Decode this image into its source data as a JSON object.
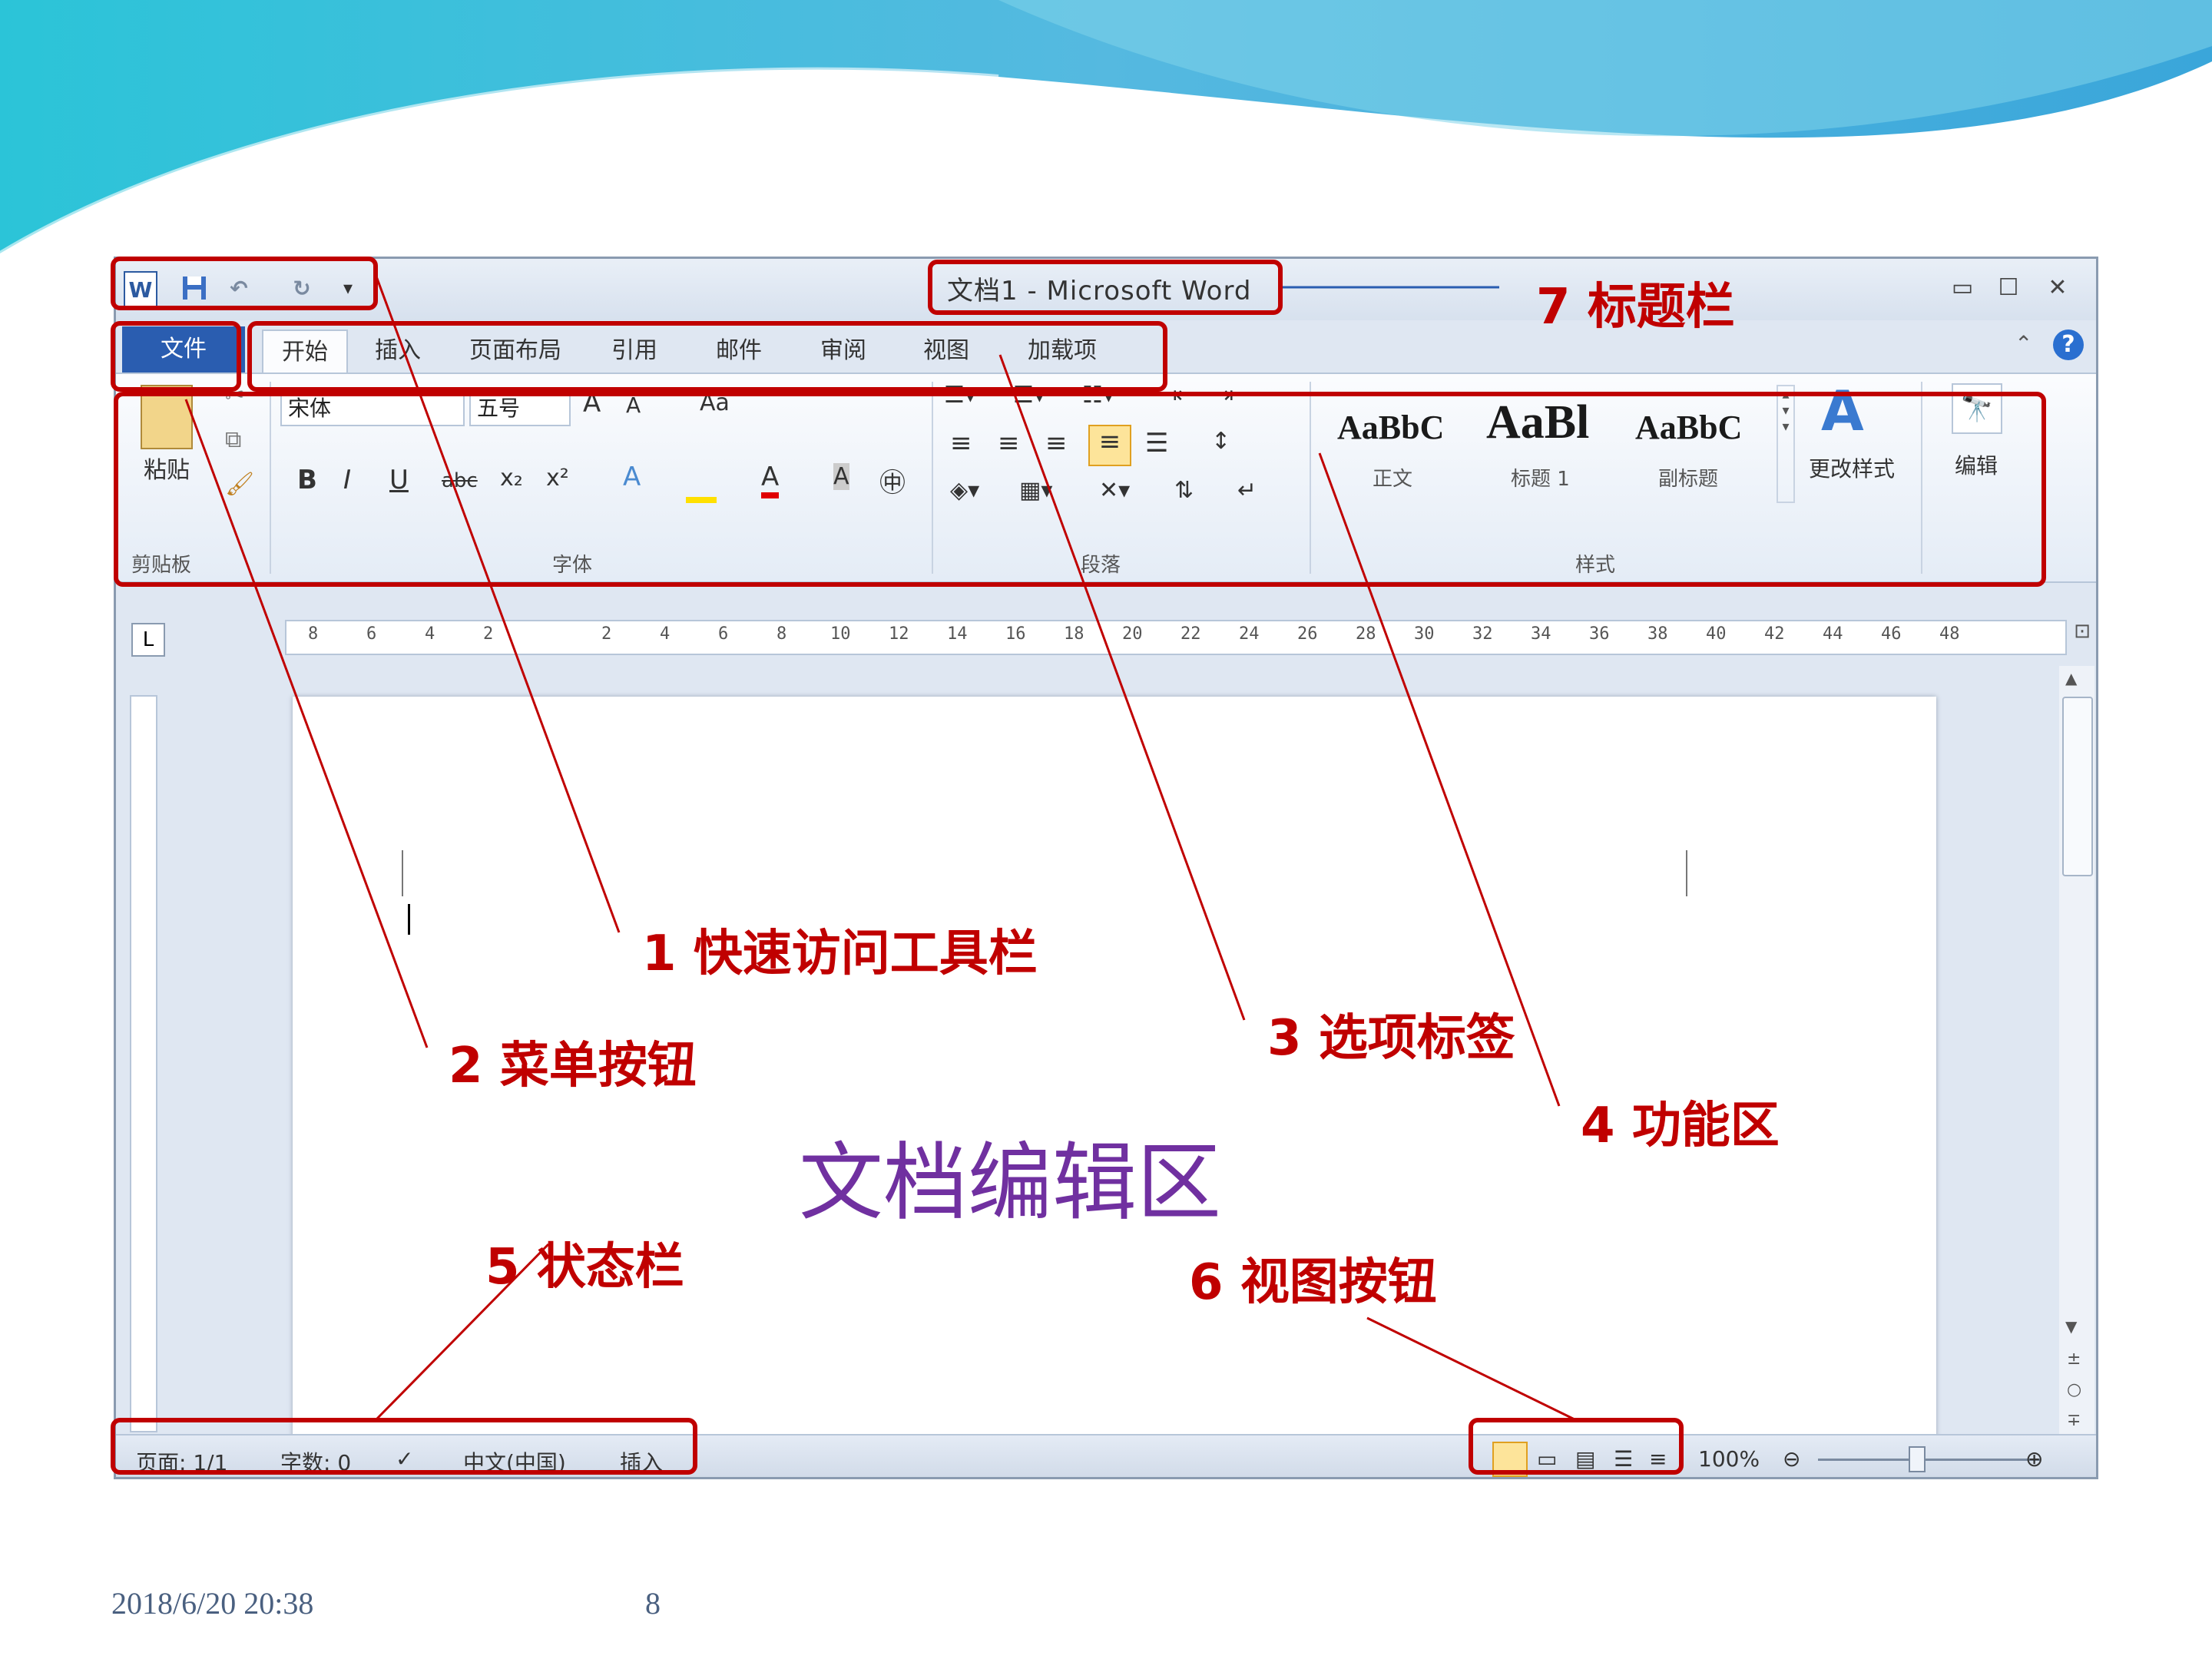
{
  "window": {
    "title": "文档1 - Microsoft Word",
    "quick_access": [
      "word-icon",
      "save-icon",
      "undo-icon",
      "redo-icon",
      "customize-icon"
    ],
    "controls": {
      "minimize": "▭",
      "maximize": "☐",
      "close": "✕"
    }
  },
  "menu": {
    "file_label": "文件"
  },
  "tabs": [
    "开始",
    "插入",
    "页面布局",
    "引用",
    "邮件",
    "审阅",
    "视图",
    "加载项"
  ],
  "ribbon": {
    "clipboard": {
      "paste_label": "粘贴",
      "group_label": "剪贴板"
    },
    "font": {
      "font_name": "宋体",
      "font_size": "五号",
      "group_label": "字体",
      "bold": "B",
      "italic": "I",
      "underline": "U",
      "strike": "abc",
      "subscript": "x₂",
      "superscript": "x²",
      "case": "Aa",
      "grow": "A",
      "shrink": "A"
    },
    "paragraph": {
      "group_label": "段落"
    },
    "styles": {
      "group_label": "样式",
      "items": [
        {
          "sample": "AaBbC",
          "name": "正文"
        },
        {
          "sample": "AaBl",
          "name": "标题 1"
        },
        {
          "sample": "AaBbC",
          "name": "副标题"
        }
      ],
      "change_styles": "更改样式"
    },
    "editing": {
      "label": "编辑"
    }
  },
  "ruler": {
    "numbers": [
      "8",
      "6",
      "4",
      "2",
      "",
      "2",
      "4",
      "6",
      "8",
      "10",
      "12",
      "14",
      "16",
      "18",
      "20",
      "22",
      "24",
      "26",
      "28",
      "30",
      "32",
      "34",
      "36",
      "38",
      "40",
      "42",
      "44",
      "46",
      "48"
    ]
  },
  "status": {
    "page": "页面: 1/1",
    "words": "字数: 0",
    "language": "中文(中国)",
    "mode": "插入",
    "zoom": "100%"
  },
  "annotations": {
    "a1": "1 快速访问工具栏",
    "a2": "2 菜单按钮",
    "a3": "3 选项标签",
    "a4": "4 功能区",
    "a5": "5 状态栏",
    "a6": "6 视图按钮",
    "a7": "7  标题栏",
    "edit_area": "文档编辑区"
  },
  "footer": {
    "date": "2018/6/20 20:38",
    "page_number": "8"
  },
  "colors": {
    "accent_red": "#c00000",
    "edit_area_purple": "#7030a0",
    "file_tab_blue": "#2a5db0"
  }
}
